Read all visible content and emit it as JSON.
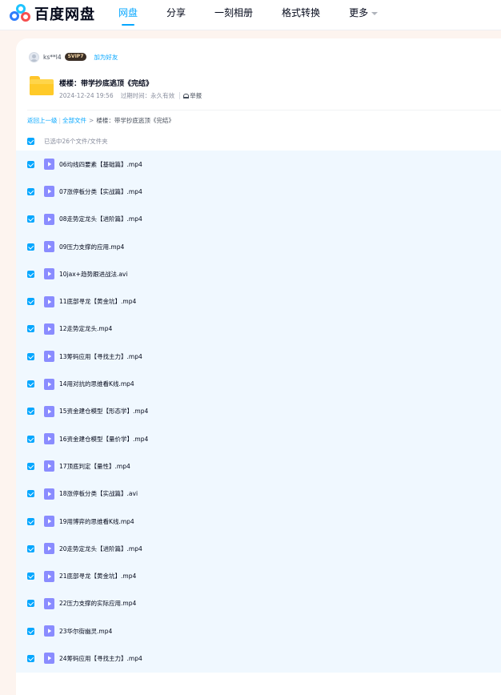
{
  "logo": {
    "text": "百度网盘"
  },
  "nav": {
    "items": [
      {
        "label": "网盘",
        "active": true
      },
      {
        "label": "分享",
        "active": false
      },
      {
        "label": "一刻相册",
        "active": false
      },
      {
        "label": "格式转换",
        "active": false
      },
      {
        "label": "更多",
        "active": false
      }
    ]
  },
  "sharer": {
    "name": "ks**l4",
    "badge": "SVIP7",
    "add_friend": "加为好友"
  },
  "share": {
    "title": "楼楼：带学抄底逃顶《完结》",
    "date": "2024-12-24 19:56",
    "expire_label": "过期时间：永久有效",
    "report": "举报"
  },
  "breadcrumb": {
    "back": "返回上一级",
    "all_files": "全部文件",
    "separator": ">",
    "current": "楼楼：带学抄底逃顶《完结》"
  },
  "selection": {
    "text": "已选中26个文件/文件夹"
  },
  "files": [
    {
      "name": "06均线四要素【基础篇】.mp4"
    },
    {
      "name": "07涨停板分类【实战篇】.mp4"
    },
    {
      "name": "08走势定龙头【进阶篇】.mp4"
    },
    {
      "name": "09压力支撑的应用.mp4"
    },
    {
      "name": "10jax+趋势跟进战法.avi"
    },
    {
      "name": "11底部寻龙【黄金坑】.mp4"
    },
    {
      "name": "12走势定龙头.mp4"
    },
    {
      "name": "13筹码应用【寻找主力】.mp4"
    },
    {
      "name": "14用对抗的思维看K线.mp4"
    },
    {
      "name": "15资金建仓模型【形态学】.mp4"
    },
    {
      "name": "16资金建仓模型【量价学】.mp4"
    },
    {
      "name": "17顶底判定【量性】.mp4"
    },
    {
      "name": "18涨停板分类【实战篇】.avi"
    },
    {
      "name": "19用博弈的思维看K线.mp4"
    },
    {
      "name": "20走势定龙头【进阶篇】.mp4"
    },
    {
      "name": "21底部寻龙【黄金坑】.mp4"
    },
    {
      "name": "22压力支撑的实际应用.mp4"
    },
    {
      "name": "23华尔街幽灵.mp4"
    },
    {
      "name": "24筹码应用【寻找主力】.mp4"
    }
  ],
  "colors": {
    "accent": "#06a7ff",
    "row_selected_bg": "#f0f8ff",
    "video_icon": "#8a8cff"
  }
}
